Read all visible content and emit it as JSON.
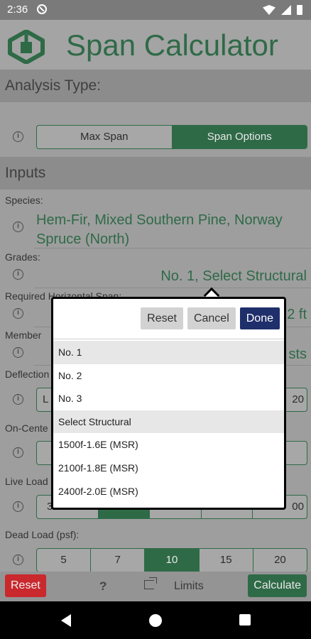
{
  "status_bar": {
    "time": "2:36"
  },
  "header": {
    "title": "Span Calculator"
  },
  "analysis": {
    "heading": "Analysis Type:",
    "options": [
      "Max Span",
      "Span Options"
    ],
    "selected": "Span Options"
  },
  "inputs": {
    "heading": "Inputs",
    "species": {
      "label": "Species:",
      "value": "Hem-Fir, Mixed Southern Pine, Norway Spruce (North)"
    },
    "grades": {
      "label": "Grades:",
      "value": "No. 1, Select Structural"
    },
    "span": {
      "label": "Required Horizontal Span:",
      "value_tail": "2 ft"
    },
    "member": {
      "label": "Member",
      "value_tail": "sts"
    },
    "deflection": {
      "label": "Deflection",
      "left_partial": "L",
      "right_partial": "20"
    },
    "oncenter": {
      "label": "On-Cente"
    },
    "liveload": {
      "label": "Live Load",
      "left_partial": "3",
      "right_partial": "00"
    },
    "deadload": {
      "label": "Dead Load (psf):",
      "options": [
        "5",
        "7",
        "10",
        "15",
        "20"
      ],
      "selected": "10"
    }
  },
  "popup": {
    "reset_label": "Reset",
    "cancel_label": "Cancel",
    "done_label": "Done",
    "options": [
      {
        "label": "No. 1",
        "selected": true
      },
      {
        "label": "No. 2",
        "selected": false
      },
      {
        "label": "No. 3",
        "selected": false
      },
      {
        "label": "Select Structural",
        "selected": true
      },
      {
        "label": "1500f-1.6E (MSR)",
        "selected": false
      },
      {
        "label": "2100f-1.8E (MSR)",
        "selected": false
      },
      {
        "label": "2400f-2.0E (MSR)",
        "selected": false
      }
    ]
  },
  "bottom_bar": {
    "reset_label": "Reset",
    "help_icon": "?",
    "limits_label": "Limits",
    "calculate_label": "Calculate"
  },
  "colors": {
    "brand_green": "#2f6a47",
    "reset_red": "#c9282d",
    "done_blue": "#1f2f6b"
  }
}
